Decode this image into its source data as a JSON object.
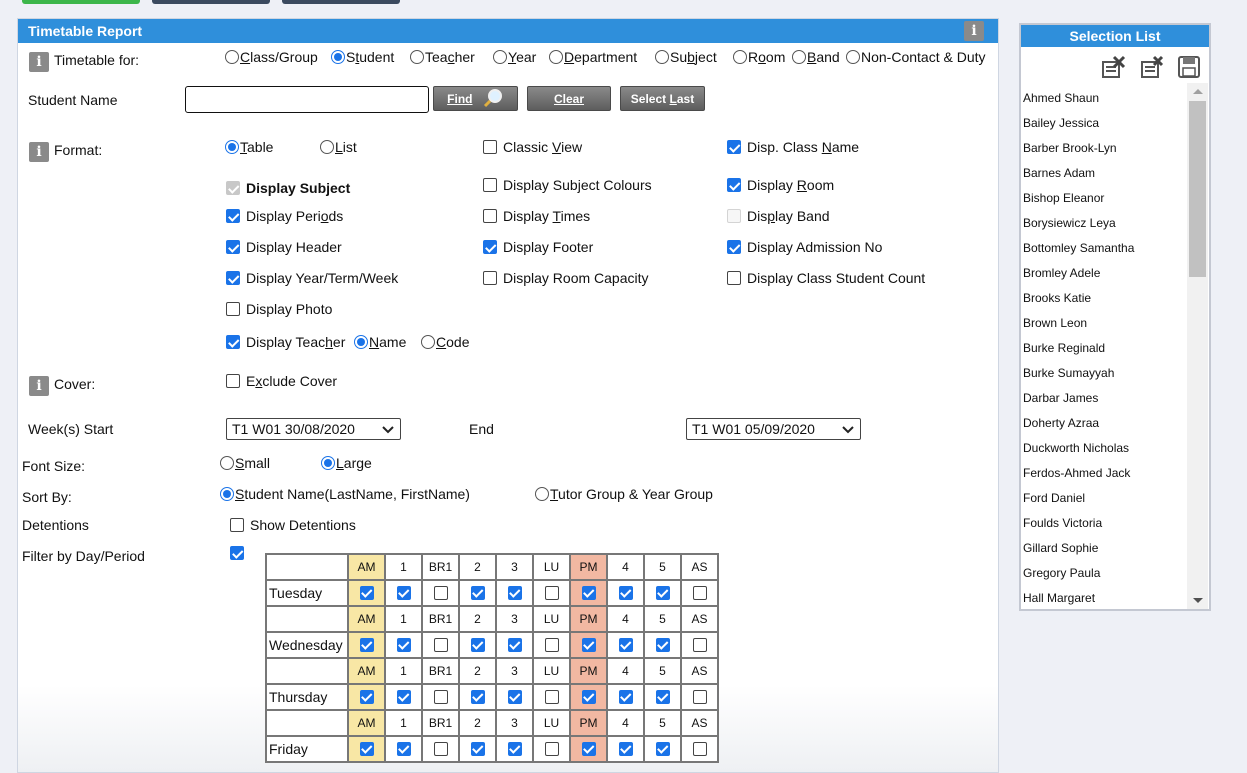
{
  "colors": {
    "header": "#2f8fdb",
    "accent": "#1a73e8",
    "am": "#f8e7a5",
    "pm": "#f2b8a2",
    "top_green": "#3cb64a",
    "top_navy": "#3b4a5f"
  },
  "panel": {
    "title": "Timetable Report"
  },
  "timetable_for": {
    "label": "Timetable for:",
    "options": [
      {
        "pre": "",
        "acc": "C",
        "post": "lass/Group",
        "checked": false
      },
      {
        "pre": "S",
        "acc": "t",
        "post": "udent",
        "checked": true
      },
      {
        "pre": "Tea",
        "acc": "c",
        "post": "her",
        "checked": false
      },
      {
        "pre": "",
        "acc": "Y",
        "post": "ear",
        "checked": false
      },
      {
        "pre": "",
        "acc": "D",
        "post": "epartment",
        "checked": false
      },
      {
        "pre": "Su",
        "acc": "b",
        "post": "ject",
        "checked": false
      },
      {
        "pre": "R",
        "acc": "o",
        "post": "om",
        "checked": false
      },
      {
        "pre": "",
        "acc": "B",
        "post": "and",
        "checked": false
      },
      {
        "pre": "Non-Contact & Duty",
        "acc": "",
        "post": "",
        "checked": false
      }
    ]
  },
  "student": {
    "label": "Student Name",
    "value": "",
    "find": "Find",
    "clear": "Clear",
    "select_last": {
      "pre": "Select ",
      "acc": "L",
      "post": "ast"
    }
  },
  "format": {
    "label": "Format:",
    "table": {
      "pre": "",
      "acc": "T",
      "post": "able"
    },
    "list": {
      "pre": "",
      "acc": "L",
      "post": "ist"
    },
    "classic_view": {
      "pre": "Classic ",
      "acc": "V",
      "post": "iew"
    },
    "disp_class_name": {
      "pre": "Disp. Class ",
      "acc": "N",
      "post": "ame"
    },
    "display_subject": "Display Subject",
    "display_subject_colours": "Display Subject Colours",
    "display_room": {
      "pre": "Display ",
      "acc": "R",
      "post": "oom"
    },
    "display_periods": {
      "pre": "Display Peri",
      "acc": "o",
      "post": "ds"
    },
    "display_times": {
      "pre": "Display ",
      "acc": "T",
      "post": "imes"
    },
    "display_band": {
      "pre": "Dis",
      "acc": "p",
      "post": "lay Band"
    },
    "display_header": "Display Header",
    "display_footer": "Display Footer",
    "display_admission": "Display Admission No",
    "display_ytw": "Display Year/Term/Week",
    "display_room_capacity": "Display Room Capacity",
    "display_class_count": "Display Class Student Count",
    "display_photo": "Display Photo",
    "display_teacher": {
      "pre": "Display Teac",
      "acc": "h",
      "post": "er"
    },
    "teacher_name": {
      "pre": "",
      "acc": "N",
      "post": "ame"
    },
    "teacher_code": {
      "pre": "",
      "acc": "C",
      "post": "ode"
    }
  },
  "cover": {
    "label": "Cover:",
    "exclude": {
      "pre": "E",
      "acc": "x",
      "post": "clude Cover"
    }
  },
  "weeks": {
    "label": "Week(s) Start",
    "start": "T1 W01 30/08/2020",
    "end_label": "End",
    "end": "T1 W01 05/09/2020"
  },
  "font_size": {
    "label": "Font Size:",
    "small": {
      "pre": "",
      "acc": "S",
      "post": "mall"
    },
    "large": {
      "pre": "",
      "acc": "L",
      "post": "arge"
    }
  },
  "sort_by": {
    "label": "Sort By:",
    "student": {
      "pre": "",
      "acc": "S",
      "post": "tudent Name(LastName, FirstName)"
    },
    "tutor": {
      "pre": "",
      "acc": "T",
      "post": "utor Group & Year Group"
    }
  },
  "detentions": {
    "label": "Detentions",
    "show": "Show Detentions"
  },
  "filter": {
    "label": "Filter by Day/Period",
    "periods": [
      "AM",
      "1",
      "BR1",
      "2",
      "3",
      "LU",
      "PM",
      "4",
      "5",
      "AS"
    ],
    "days": [
      {
        "name": "Tuesday",
        "checks": [
          true,
          true,
          false,
          true,
          true,
          false,
          true,
          true,
          true,
          false
        ]
      },
      {
        "name": "Wednesday",
        "checks": [
          true,
          true,
          false,
          true,
          true,
          false,
          true,
          true,
          true,
          false
        ]
      },
      {
        "name": "Thursday",
        "checks": [
          true,
          true,
          false,
          true,
          true,
          false,
          true,
          true,
          true,
          false
        ]
      },
      {
        "name": "Friday",
        "checks": [
          true,
          true,
          false,
          true,
          true,
          false,
          true,
          true,
          true,
          false
        ]
      }
    ]
  },
  "selection_list": {
    "title": "Selection List",
    "icons": [
      "remove-selected-icon",
      "remove-all-icon",
      "save-icon"
    ],
    "items": [
      "Ahmed Shaun",
      "Bailey Jessica",
      "Barber Brook-Lyn",
      "Barnes Adam",
      "Bishop Eleanor",
      "Borysiewicz Leya",
      "Bottomley Samantha",
      "Bromley Adele",
      "Brooks Katie",
      "Brown Leon",
      "Burke Reginald",
      "Burke Sumayyah",
      "Darbar James",
      "Doherty Azraa",
      "Duckworth Nicholas",
      "Ferdos-Ahmed Jack",
      "Ford Daniel",
      "Foulds Victoria",
      "Gillard Sophie",
      "Gregory Paula",
      "Hall Margaret"
    ]
  }
}
